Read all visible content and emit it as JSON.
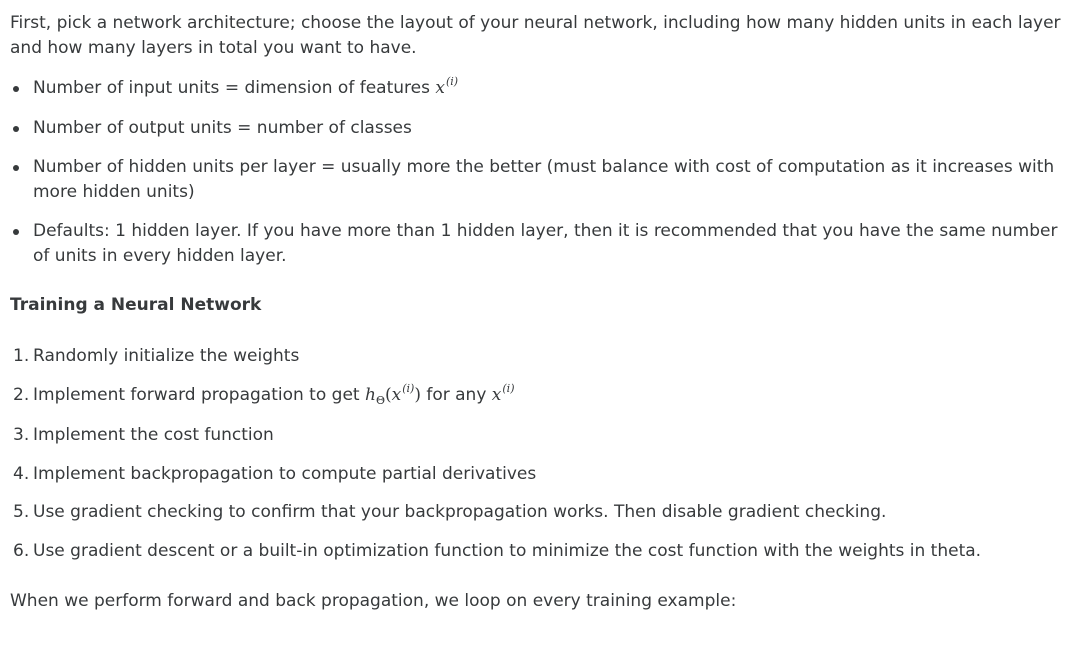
{
  "intro": "First, pick a network architecture; choose the layout of your neural network, including how many hidden units in each layer and how many layers in total you want to have.",
  "bullets": [
    "Number of input units = dimension of features ",
    "Number of output units = number of classes",
    "Number of hidden units per layer = usually more the better (must balance with cost of computation as it increases with more hidden units)",
    "Defaults: 1 hidden layer. If you have more than 1 hidden layer, then it is recommended that you have the same number of units in every hidden layer."
  ],
  "math": {
    "x": "x",
    "i_sup": "(i)",
    "h": "h",
    "theta_sub": "Θ",
    "lparen": "(",
    "rparen": ")"
  },
  "heading": "Training a Neural Network",
  "steps": [
    {
      "num": "1.",
      "text": "Randomly initialize the weights"
    },
    {
      "num": "2.",
      "text": "Implement forward propagation to get ",
      "mid": " for any "
    },
    {
      "num": "3.",
      "text": "Implement the cost function"
    },
    {
      "num": "4.",
      "text": "Implement backpropagation to compute partial derivatives"
    },
    {
      "num": "5.",
      "text": "Use gradient checking to confirm that your backpropagation works. Then disable gradient checking."
    },
    {
      "num": "6.",
      "text": "Use gradient descent or a built-in optimization function to minimize the cost function with the weights in theta."
    }
  ],
  "closing": "When we perform forward and back propagation, we loop on every training example:"
}
